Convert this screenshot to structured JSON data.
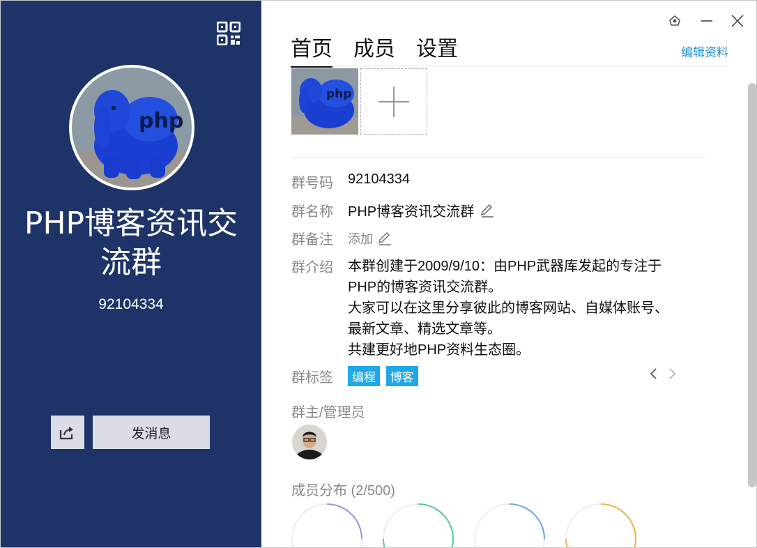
{
  "left": {
    "group_name": "PHP博客资讯交流群",
    "group_id": "92104334",
    "send_message_label": "发消息",
    "icons": {
      "qr": "qr-code-icon",
      "share": "share-icon"
    }
  },
  "tabs": [
    {
      "label": "首页",
      "active": true
    },
    {
      "label": "成员",
      "active": false
    },
    {
      "label": "设置",
      "active": false
    }
  ],
  "edit_profile_label": "编辑资料",
  "info": {
    "group_number_label": "群号码",
    "group_number_value": "92104334",
    "group_name_label": "群名称",
    "group_name_value": "PHP博客资讯交流群",
    "group_remark_label": "群备注",
    "group_remark_value": "添加",
    "group_intro_label": "群介绍",
    "group_intro_lines": [
      "本群创建于2009/9/10：由PHP武器库发起的专注于",
      "PHP的博客资讯交流群。",
      "大家可以在这里分享彼此的博客网站、自媒体账号、",
      "最新文章、精选文章等。",
      "共建更好地PHP资料生态圈。"
    ],
    "group_tags_label": "群标签",
    "tags": [
      "编程",
      "博客"
    ],
    "admins_label": "群主/管理员",
    "member_distribution_label": "成员分布 (2/500)"
  },
  "colors": {
    "left_bg": "#1e3469",
    "accent_link": "#1c8ed6",
    "tag_bg": "#20a8e6",
    "ring_colors": [
      "#a889e6",
      "#52cf93",
      "#6aa8e8",
      "#f3b043"
    ]
  }
}
